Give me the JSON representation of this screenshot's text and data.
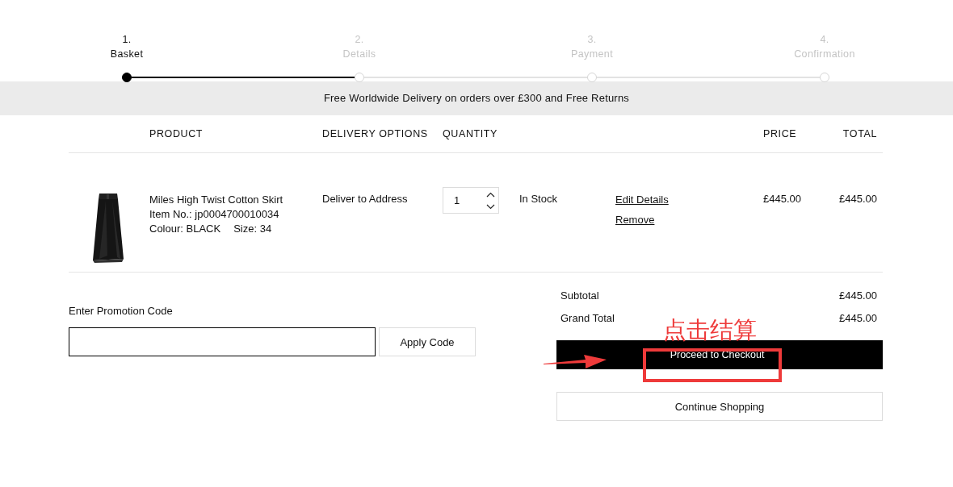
{
  "steps": [
    {
      "number": "1.",
      "label": "Basket",
      "selected": true
    },
    {
      "number": "2.",
      "label": "Details",
      "selected": false
    },
    {
      "number": "3.",
      "label": "Payment",
      "selected": false
    },
    {
      "number": "4.",
      "label": "Confirmation",
      "selected": false
    }
  ],
  "banner": "Free Worldwide Delivery on orders over £300 and Free Returns",
  "table": {
    "columns": [
      "PRODUCT",
      "DELIVERY OPTIONS",
      "QUANTITY",
      "PRICE",
      "TOTAL"
    ],
    "rows": [
      {
        "name": "Miles High Twist Cotton Skirt",
        "item_no": "Item No.: jp0004700010034",
        "colour": "Colour: BLACK",
        "size": "Size: 34",
        "delivery": "Deliver to Address",
        "quantity": "1",
        "stock": "In Stock",
        "links": [
          "Edit Details",
          "Remove"
        ],
        "price": "£445.00",
        "total": "£445.00"
      }
    ]
  },
  "promotion": {
    "label": "Enter Promotion Code",
    "button": "Apply Code"
  },
  "summary": {
    "lines": [
      {
        "label": "Subtotal",
        "value": "£445.00"
      },
      {
        "label": "Grand Total",
        "value": "£445.00"
      }
    ],
    "checkout_button": "Proceed to Checkout",
    "continue_button": "Continue Shopping"
  },
  "annotation": {
    "text": "点击结算"
  }
}
